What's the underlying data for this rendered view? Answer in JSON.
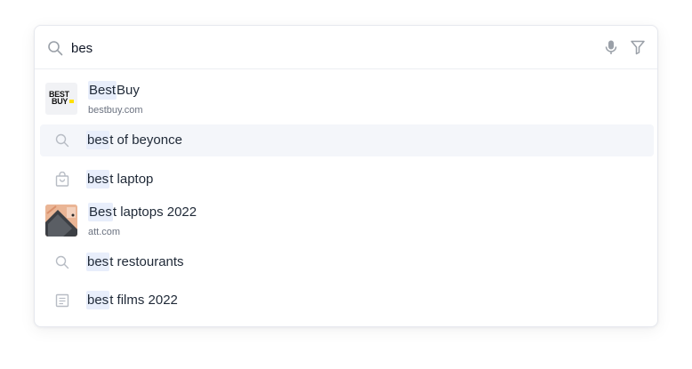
{
  "search": {
    "query": "bes"
  },
  "toolbar": {
    "mic_icon": "microphone-icon",
    "filter_icon": "filter-icon"
  },
  "colors": {
    "highlight": "#e8eefb",
    "active_row": "#f4f6fa",
    "bestbuy_yellow": "#ffe000"
  },
  "results": [
    {
      "type": "site",
      "highlight": "Best",
      "rest": "Buy",
      "domain": "bestbuy.com",
      "thumb": {
        "line1": "BEST",
        "line2": "BUY"
      }
    },
    {
      "type": "search",
      "icon": "search-icon",
      "highlight": "bes",
      "rest": "t of beyonce",
      "active": true
    },
    {
      "type": "shopping",
      "icon": "shopping-bag-icon",
      "highlight": "bes",
      "rest": "t laptop"
    },
    {
      "type": "site",
      "highlight": "Bes",
      "rest": "t laptops 2022",
      "domain": "att.com",
      "thumb": "laptop-photo"
    },
    {
      "type": "search",
      "icon": "search-icon",
      "highlight": "bes",
      "rest": "t restourants"
    },
    {
      "type": "document",
      "icon": "document-icon",
      "highlight": "bes",
      "rest": "t films 2022"
    }
  ]
}
